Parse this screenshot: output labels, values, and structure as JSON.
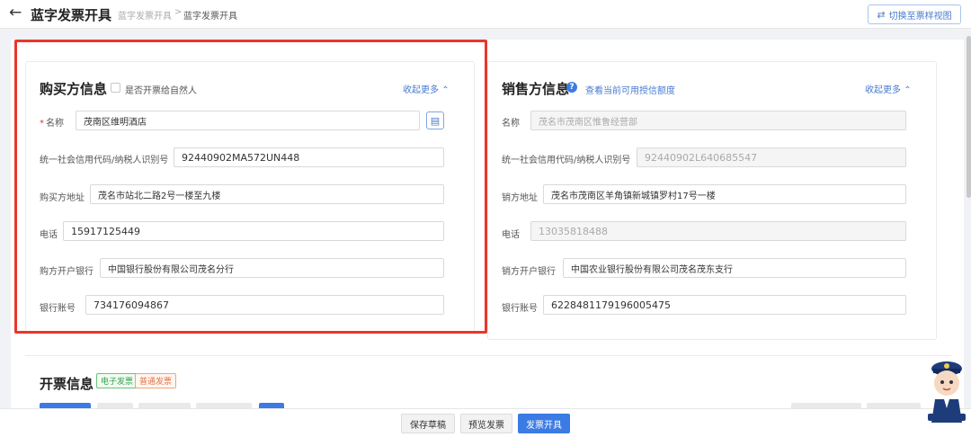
{
  "header": {
    "title": "蓝字发票开具",
    "breadcrumb_parent": "蓝字发票开具",
    "breadcrumb_sep": ">",
    "breadcrumb_current": "蓝字发票开具",
    "switch_label": "切换至票样视图"
  },
  "buyer": {
    "title": "购买方信息",
    "natural_person_label": "是否开票给自然人",
    "toggle_label": "收起更多",
    "name_label": "名称",
    "name_value": "茂南区维明酒店",
    "taxid_label": "统一社会信用代码/纳税人识别号",
    "taxid_value": "92440902MA572UN448",
    "address_label": "购买方地址",
    "address_value": "茂名市站北二路2号一楼至九楼",
    "phone_label": "电话",
    "phone_value": "15917125449",
    "bank_label": "购方开户银行",
    "bank_value": "中国银行股份有限公司茂名分行",
    "account_label": "银行账号",
    "account_value": "734176094867"
  },
  "seller": {
    "title": "销售方信息",
    "quota_link": "查看当前可用授信额度",
    "toggle_label": "收起更多",
    "name_label": "名称",
    "name_value": "茂名市茂南区惟鲁经营部",
    "taxid_label": "统一社会信用代码/纳税人识别号",
    "taxid_value": "92440902L640685547",
    "address_label": "销方地址",
    "address_value": "茂名市茂南区羊角镇新城镇罗村17号一楼",
    "phone_label": "电话",
    "phone_value": "13035818488",
    "bank_label": "销方开户银行",
    "bank_value": "中国农业银行股份有限公司茂名茂东支行",
    "account_label": "银行账号",
    "account_value": "6228481179196005475"
  },
  "invoice": {
    "title": "开票信息",
    "tag_electronic": "电子发票",
    "tag_normal": "普通发票"
  },
  "footer": {
    "save_draft": "保存草稿",
    "preview": "预览发票",
    "issue": "发票开具"
  },
  "colors": {
    "accent": "#3b7be3",
    "highlight": "#e8372b"
  }
}
